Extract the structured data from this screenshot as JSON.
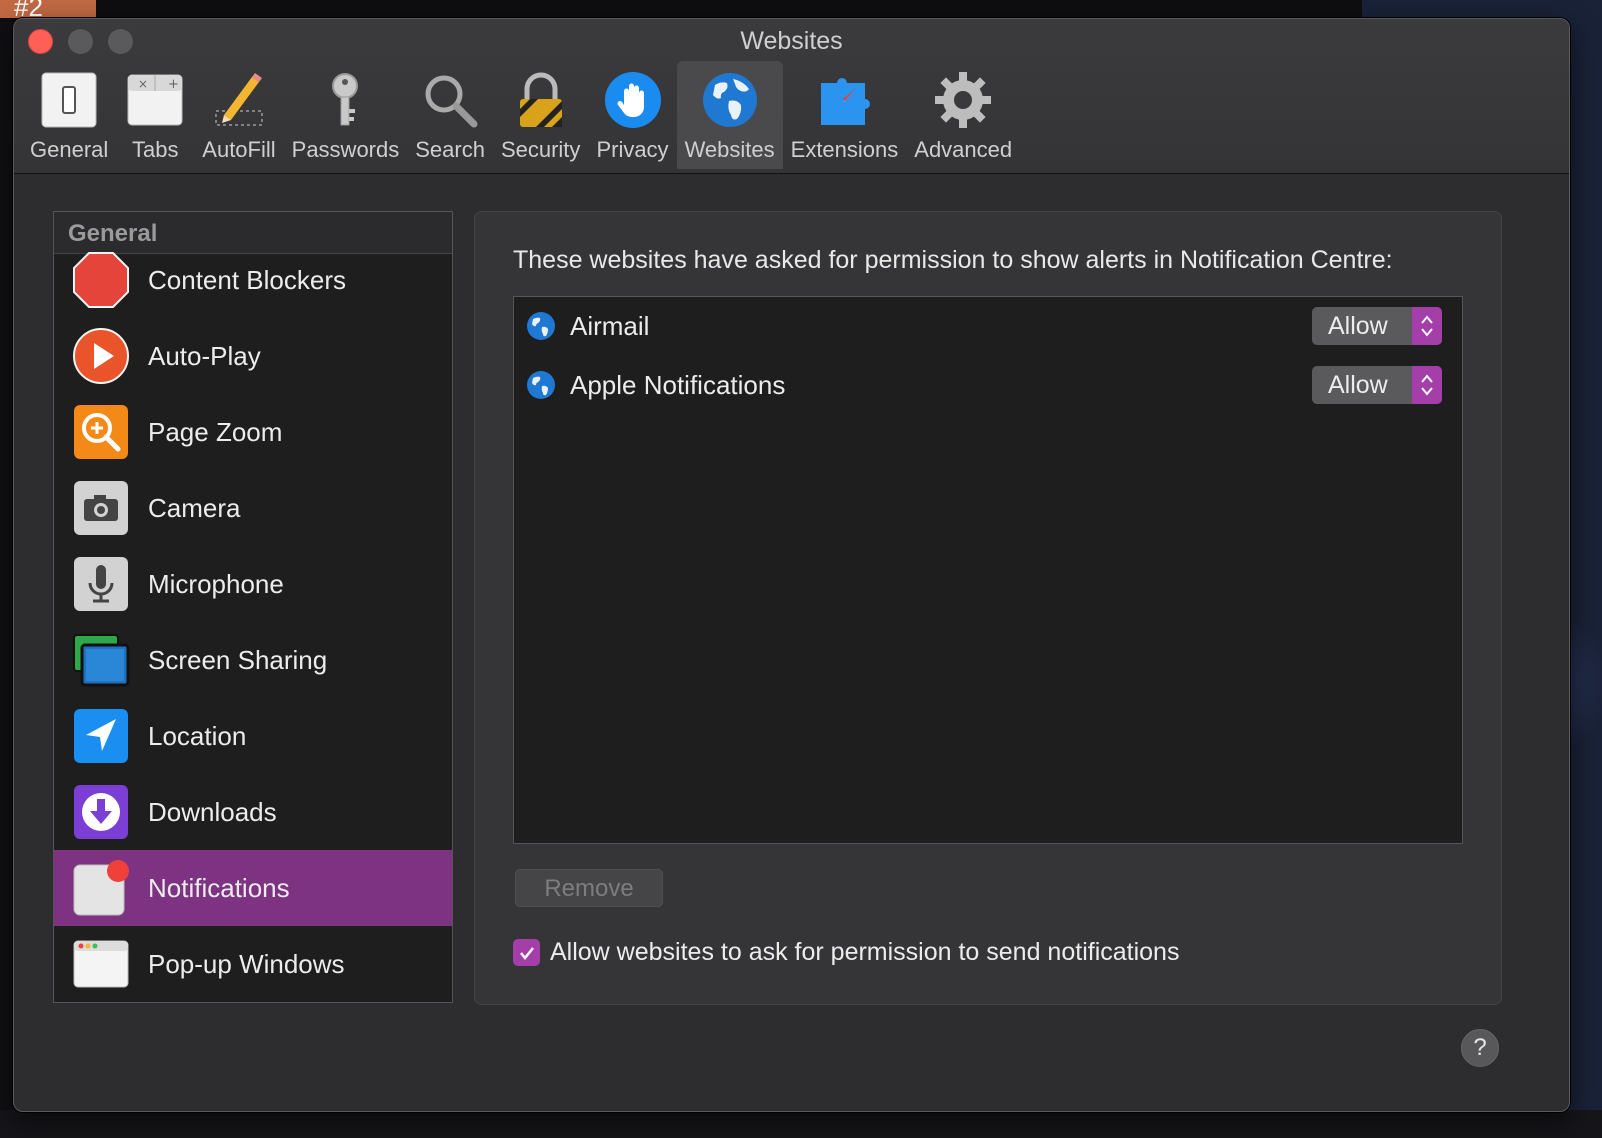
{
  "desktop": {
    "badge": "#2"
  },
  "window": {
    "title": "Websites",
    "toolbar": [
      {
        "label": "General",
        "icon": "general-switch-icon"
      },
      {
        "label": "Tabs",
        "icon": "tabs-icon"
      },
      {
        "label": "AutoFill",
        "icon": "pencil-icon"
      },
      {
        "label": "Passwords",
        "icon": "key-icon"
      },
      {
        "label": "Search",
        "icon": "magnifier-icon"
      },
      {
        "label": "Security",
        "icon": "padlock-icon"
      },
      {
        "label": "Privacy",
        "icon": "hand-icon"
      },
      {
        "label": "Websites",
        "icon": "globe-icon",
        "active": true
      },
      {
        "label": "Extensions",
        "icon": "puzzle-compass-icon"
      },
      {
        "label": "Advanced",
        "icon": "gear-icon"
      }
    ]
  },
  "sidebar": {
    "header": "General",
    "items": [
      {
        "label": "Content Blockers",
        "icon": "stop-sign-icon"
      },
      {
        "label": "Auto-Play",
        "icon": "play-icon"
      },
      {
        "label": "Page Zoom",
        "icon": "zoom-icon"
      },
      {
        "label": "Camera",
        "icon": "camera-icon"
      },
      {
        "label": "Microphone",
        "icon": "microphone-icon"
      },
      {
        "label": "Screen Sharing",
        "icon": "screen-sharing-icon"
      },
      {
        "label": "Location",
        "icon": "location-arrow-icon"
      },
      {
        "label": "Downloads",
        "icon": "download-icon"
      },
      {
        "label": "Notifications",
        "icon": "notification-badge-icon",
        "selected": true
      },
      {
        "label": "Pop-up Windows",
        "icon": "popup-window-icon"
      }
    ]
  },
  "panel": {
    "description": "These websites have asked for permission to show alerts in Notification Centre:",
    "sites": [
      {
        "name": "Airmail",
        "setting": "Allow"
      },
      {
        "name": "Apple Notifications",
        "setting": "Allow"
      }
    ],
    "remove_label": "Remove",
    "allow_checkbox": {
      "label": "Allow websites to ask for permission to send notifications",
      "checked": true
    }
  },
  "help_label": "?",
  "colors": {
    "selection": "#7d3382",
    "accent": "#a43ea8",
    "close": "#fe5f57"
  }
}
